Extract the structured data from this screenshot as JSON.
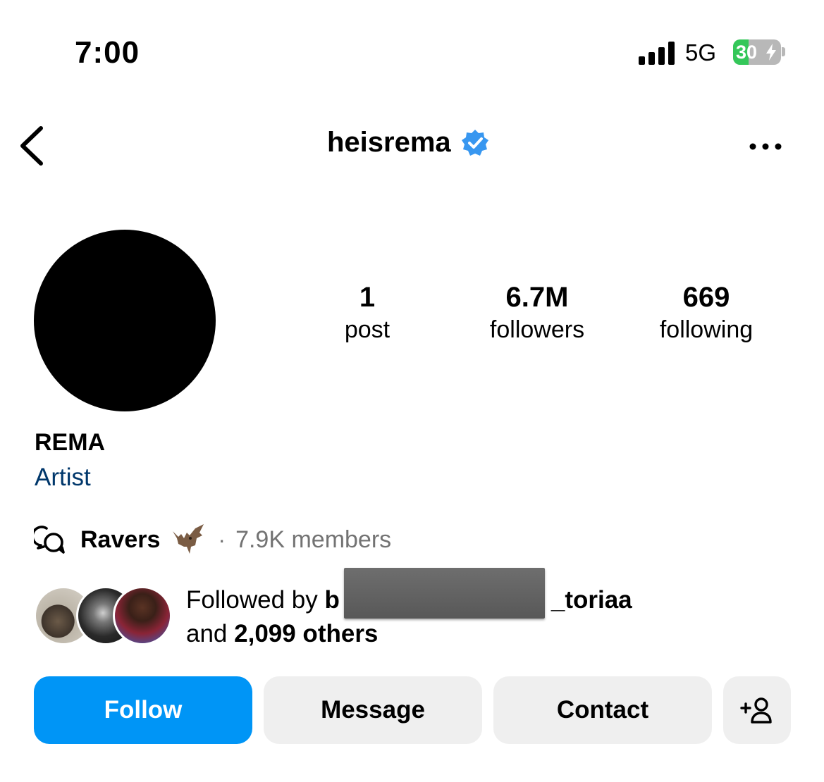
{
  "status_bar": {
    "time": "7:00",
    "network": "5G",
    "battery_level": "30",
    "icons": [
      "signal-icon",
      "battery-charging-icon"
    ]
  },
  "header": {
    "username": "heisrema",
    "icons": [
      "back-chevron-icon",
      "verified-badge-icon",
      "more-options-icon"
    ]
  },
  "profile": {
    "stats": [
      {
        "value": "1",
        "label": "post"
      },
      {
        "value": "6.7M",
        "label": "followers"
      },
      {
        "value": "669",
        "label": "following"
      }
    ],
    "display_name": "REMA",
    "category": "Artist"
  },
  "channel": {
    "name": "Ravers",
    "emoji": "bat-emoji",
    "separator": "·",
    "members": "7.9K members",
    "icon": "broadcast-channel-icon"
  },
  "followed_by": {
    "prefix": "Followed by ",
    "visible_start": "b",
    "visible_end": "_toriaa",
    "line2_prefix": "and ",
    "others": "2,099 others"
  },
  "actions": {
    "follow": "Follow",
    "message": "Message",
    "contact": "Contact",
    "add_icon": "add-person-icon"
  },
  "colors": {
    "primary": "#0095f6",
    "verified": "#3897f0",
    "category_link": "#00376b",
    "secondary_text": "#737373",
    "button_bg": "#efefef",
    "battery_green": "#34c759"
  }
}
